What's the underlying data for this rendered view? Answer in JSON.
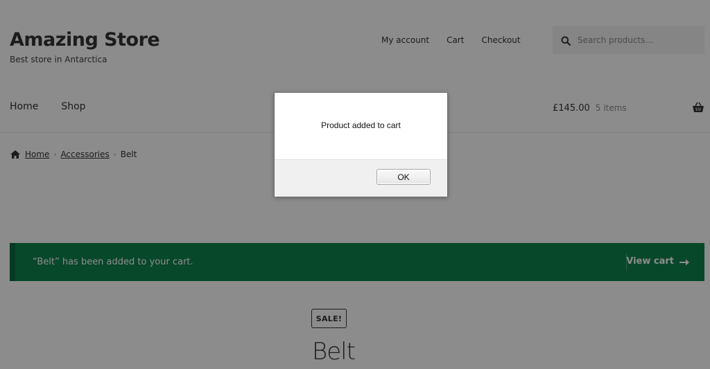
{
  "header": {
    "site_title": "Amazing Store",
    "tagline": "Best store in Antarctica",
    "secondary_nav": [
      "My account",
      "Cart",
      "Checkout"
    ],
    "search": {
      "placeholder": "Search products…",
      "icon": "search-icon"
    }
  },
  "primary_nav": [
    "Home",
    "Shop"
  ],
  "cart": {
    "amount": "£145.00",
    "count": "5 items",
    "icon": "basket-icon"
  },
  "breadcrumb": {
    "home": "Home",
    "category": "Accessories",
    "current": "Belt",
    "icon": "home-icon"
  },
  "notice": {
    "message": "“Belt” has been added to your cart.",
    "action": "View cart",
    "background": "#0f834d"
  },
  "product": {
    "badge": "SALE!",
    "title": "Belt"
  },
  "dialog": {
    "message": "Product added to cart",
    "ok_label": "OK"
  }
}
